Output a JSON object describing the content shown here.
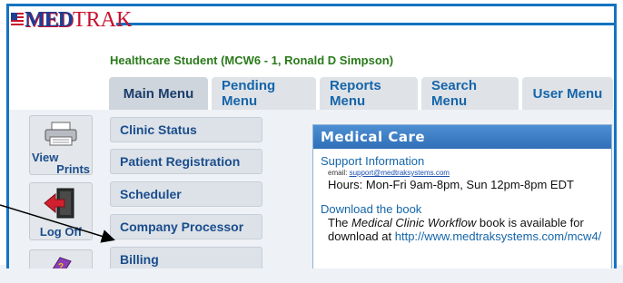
{
  "logo": {
    "part1": "MED",
    "part2": "TRAK"
  },
  "student": "Healthcare Student (MCW6 - 1, Ronald D Simpson)",
  "tabs": [
    {
      "label": "Main Menu",
      "active": true
    },
    {
      "label": "Pending Menu"
    },
    {
      "label": "Reports Menu"
    },
    {
      "label": "Search Menu"
    },
    {
      "label": "User Menu"
    }
  ],
  "side_icons": [
    {
      "label1": "View",
      "label2": "Prints",
      "icon": "printer-icon"
    },
    {
      "label1": "Log Off",
      "icon": "exit-door-icon"
    },
    {
      "label1": "",
      "icon": "book-icon"
    }
  ],
  "menu_buttons": [
    "Clinic Status",
    "Patient Registration",
    "Scheduler",
    "Company Processor",
    "Billing"
  ],
  "panel": {
    "title": "Medical Care",
    "support_title": "Support Information",
    "email_label": "email:",
    "email": "support@medtraksystems.com",
    "hours": "Hours:  Mon-Fri 9am-8pm, Sun 12pm-8pm EDT",
    "book_title": "Download the book",
    "book_line1_pre": "The ",
    "book_line1_em": "Medical Clinic Workflow",
    "book_line1_post": " book is available for",
    "book_line2_pre": "download at ",
    "book_url": "http://www.medtraksystems.com/mcw4/"
  },
  "colors": {
    "brand_blue": "#1473c0",
    "tab_text": "#1565a9",
    "student_green": "#2a7a1b"
  }
}
